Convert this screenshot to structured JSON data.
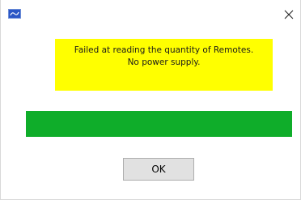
{
  "window": {
    "app_icon": "application-logo-icon",
    "close_icon": "close-icon"
  },
  "message": {
    "line1": "Failed at reading the quantity of Remotes.",
    "line2": "No power supply.",
    "background_color": "#ffff00"
  },
  "status_bar": {
    "color": "#0fad2a"
  },
  "buttons": {
    "ok_label": "OK"
  }
}
